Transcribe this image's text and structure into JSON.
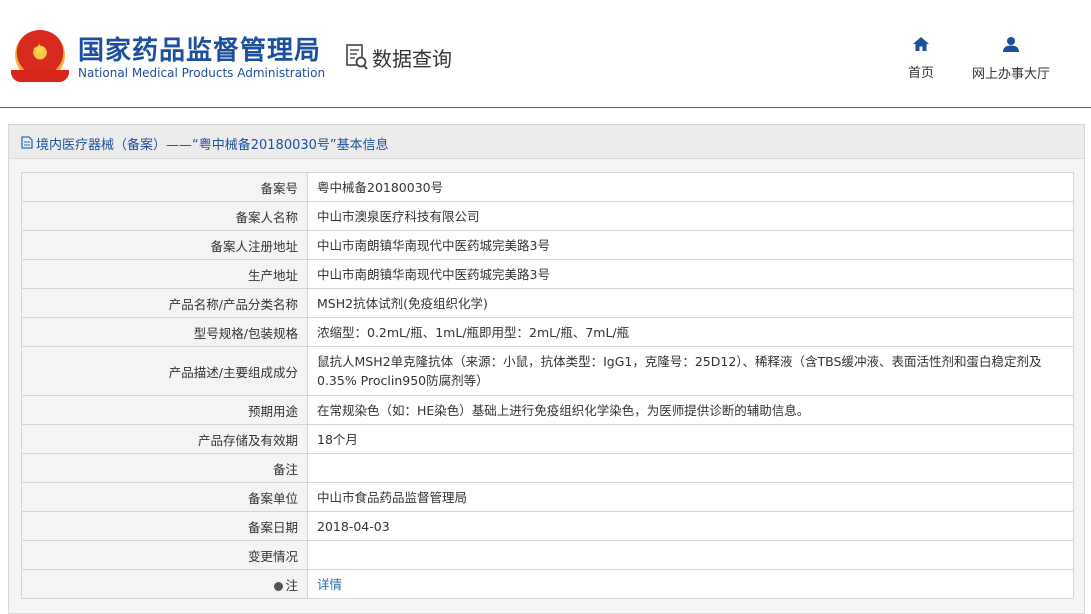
{
  "header": {
    "org_name_cn": "国家药品监督管理局",
    "org_name_en": "National Medical Products Administration",
    "query_title": "数据查询",
    "nav": [
      {
        "label": "首页",
        "icon": "home-icon"
      },
      {
        "label": "网上办事大厅",
        "icon": "user-icon"
      }
    ]
  },
  "panel": {
    "title": "境内医疗器械（备案）——“粤中械备20180030号”基本信息"
  },
  "table": {
    "rows": [
      {
        "label": "备案号",
        "value": "粤中械备20180030号"
      },
      {
        "label": "备案人名称",
        "value": "中山市澳泉医疗科技有限公司"
      },
      {
        "label": "备案人注册地址",
        "value": "中山市南朗镇华南现代中医药城完美路3号"
      },
      {
        "label": "生产地址",
        "value": "中山市南朗镇华南现代中医药城完美路3号"
      },
      {
        "label": "产品名称/产品分类名称",
        "value": "MSH2抗体试剂(免疫组织化学)"
      },
      {
        "label": "型号规格/包装规格",
        "value": "浓缩型：0.2mL/瓶、1mL/瓶即用型：2mL/瓶、7mL/瓶"
      },
      {
        "label": "产品描述/主要组成成分",
        "value": "鼠抗人MSH2单克隆抗体（来源：小鼠，抗体类型：IgG1，克隆号：25D12）、稀释液（含TBS缓冲液、表面活性剂和蛋白稳定剂及0.35% Proclin950防腐剂等）"
      },
      {
        "label": "预期用途",
        "value": "在常规染色（如：HE染色）基础上进行免疫组织化学染色，为医师提供诊断的辅助信息。"
      },
      {
        "label": "产品存储及有效期",
        "value": "18个月"
      },
      {
        "label": "备注",
        "value": ""
      },
      {
        "label": "备案单位",
        "value": "中山市食品药品监督管理局"
      },
      {
        "label": "备案日期",
        "value": "2018-04-03"
      },
      {
        "label": "变更情况",
        "value": ""
      },
      {
        "label": "注",
        "value": "详情"
      }
    ]
  },
  "colors": {
    "brand_blue": "#1c4f9c",
    "link_blue": "#2a6bb5",
    "label_bg": "#f4f4f4"
  }
}
